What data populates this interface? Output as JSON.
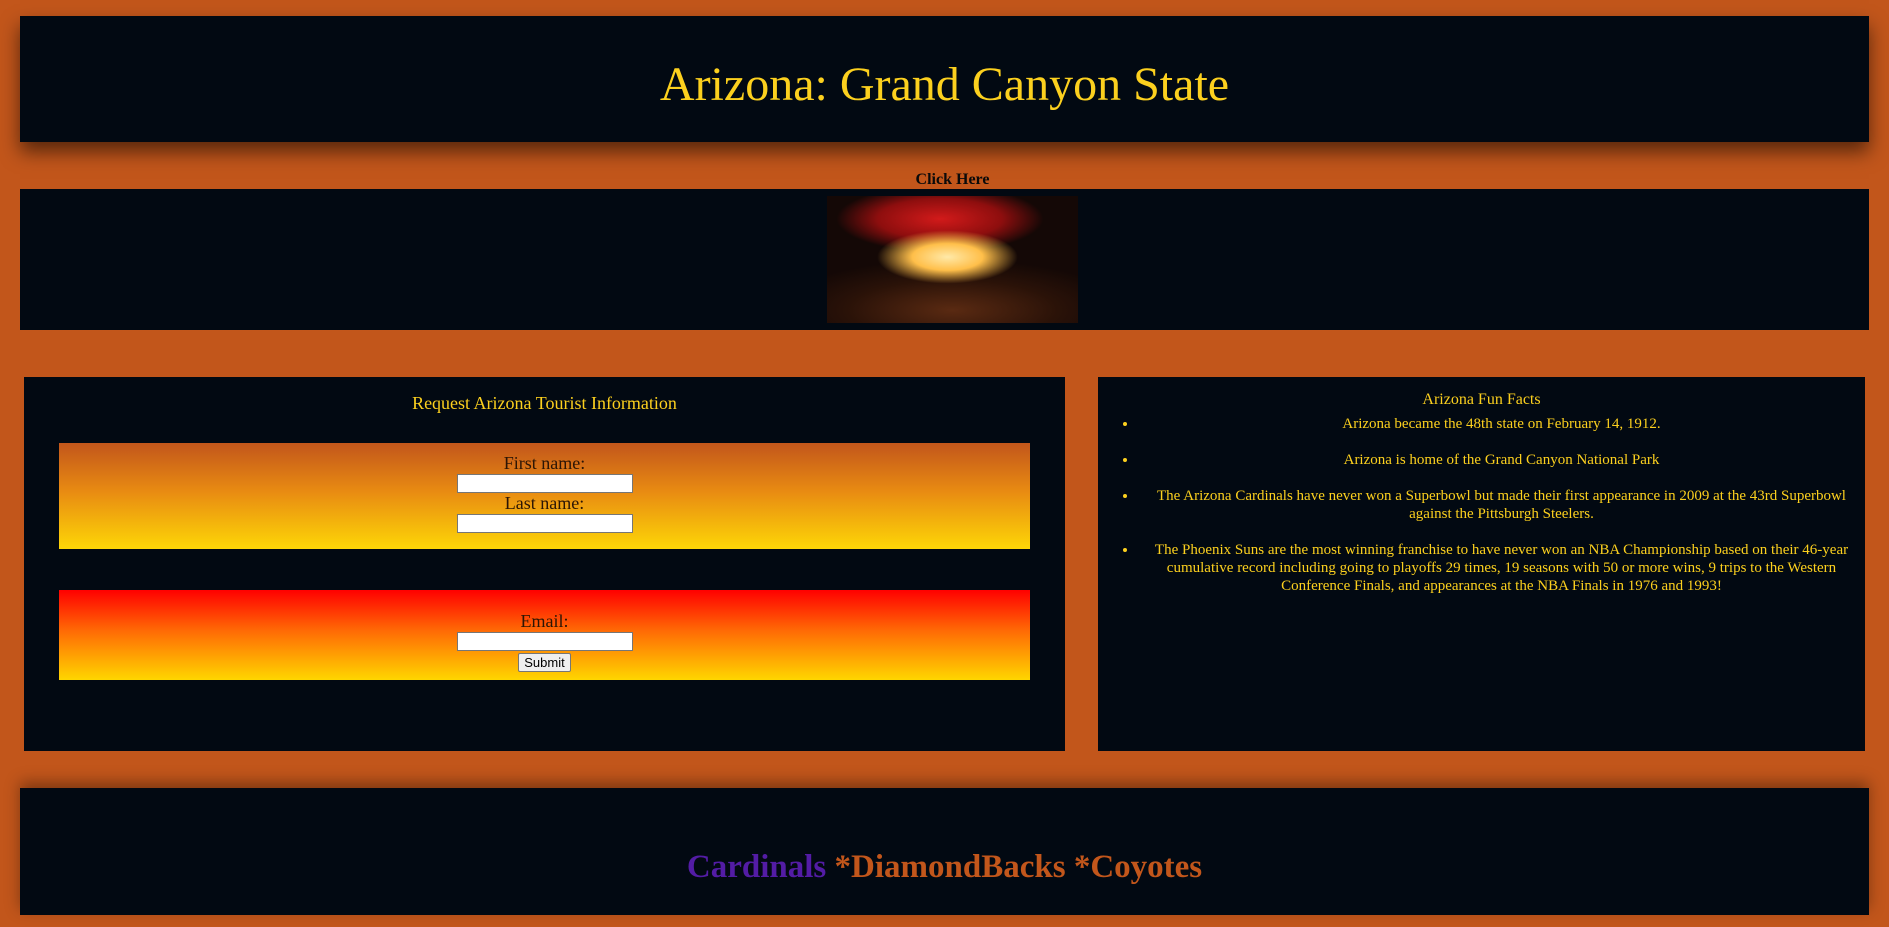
{
  "header": {
    "title": "Arizona: Grand Canyon State"
  },
  "banner": {
    "link_label": "Click Here",
    "photo_icon": "canyon-arch-photo"
  },
  "form": {
    "title": "Request Arizona Tourist Information",
    "first_name_label": "First name:",
    "first_name_value": "",
    "last_name_label": "Last name:",
    "last_name_value": "",
    "email_label": "Email:",
    "email_value": "",
    "submit_label": "Submit"
  },
  "facts": {
    "title": "Arizona Fun Facts",
    "items": [
      "Arizona became the 48th state on February 14, 1912.",
      "Arizona is home of the Grand Canyon National Park",
      "The Arizona Cardinals have never won a Superbowl but made their first appearance in 2009 at the 43rd Superbowl against the Pittsburgh Steelers.",
      "The Phoenix Suns are the most winning franchise to have never won an NBA Championship based on their 46-year cumulative record including going to playoffs 29 times, 19 seasons with 50 or more wins, 9 trips to the Western Conference Finals, and appearances at the NBA Finals in 1976 and 1993!"
    ]
  },
  "footer": {
    "team1": "Cardinals",
    "team2": "*DiamondBacks",
    "team3": "*Coyotes"
  },
  "colors": {
    "background": "#c2561b",
    "panel": "#020912",
    "accent_gold": "#fcd01e",
    "cardinals_purple": "#531ca5"
  }
}
